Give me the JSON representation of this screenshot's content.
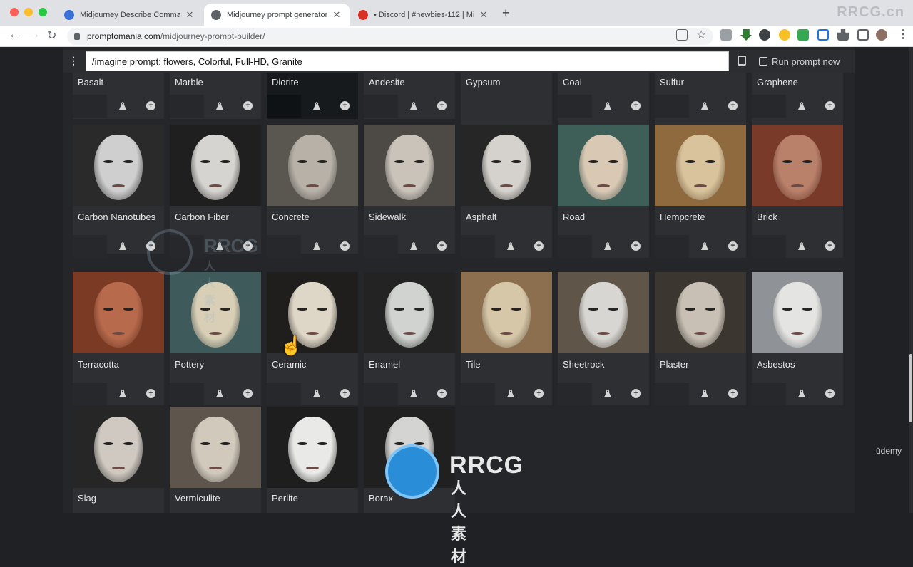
{
  "browser": {
    "tabs": [
      {
        "title": "Midjourney Describe Comman",
        "active": false,
        "favicon_color": "#3b6fd8"
      },
      {
        "title": "Midjourney prompt generator",
        "active": true,
        "favicon_color": "#5f6368"
      },
      {
        "title": "• Discord | #newbies-112 | Mid",
        "active": false,
        "favicon_color": "#d93025"
      }
    ],
    "new_tab": "+",
    "close": "✕",
    "url_domain": "promptomania.com",
    "url_path": "/midjourney-prompt-builder/",
    "watermark": "RRCG.cn"
  },
  "app": {
    "prompt_text": "/imagine prompt: flowers, Colorful, Full-HD, Granite",
    "run_label": "Run prompt now",
    "menu_icon": "⋮"
  },
  "materials_top": [
    {
      "name": "Basalt"
    },
    {
      "name": "Marble"
    },
    {
      "name": "Diorite"
    },
    {
      "name": "Andesite"
    },
    {
      "name": "Gypsum"
    },
    {
      "name": "Coal"
    },
    {
      "name": "Sulfur"
    },
    {
      "name": "Graphene"
    }
  ],
  "materials_row1": [
    {
      "name": "Carbon Nanotubes",
      "tone": "#cfcfcf",
      "bg": "#2a2a2a"
    },
    {
      "name": "Carbon Fiber",
      "tone": "#d6d4d0",
      "bg": "#1f1f1f"
    },
    {
      "name": "Concrete",
      "tone": "#b7b1a8",
      "bg": "#5a5650"
    },
    {
      "name": "Sidewalk",
      "tone": "#c9c3ba",
      "bg": "#4d4a46"
    },
    {
      "name": "Asphalt",
      "tone": "#d5d2cd",
      "bg": "#262626"
    },
    {
      "name": "Road",
      "tone": "#d9c8b4",
      "bg": "#3e5f58"
    },
    {
      "name": "Hempcrete",
      "tone": "#d8c39c",
      "bg": "#8f6a3e"
    },
    {
      "name": "Brick",
      "tone": "#b9806a",
      "bg": "#7a3a2a"
    }
  ],
  "materials_row2": [
    {
      "name": "Terracotta",
      "tone": "#b86a4c",
      "bg": "#7a3a24"
    },
    {
      "name": "Pottery",
      "tone": "#d9cfb6",
      "bg": "#3f5a5a"
    },
    {
      "name": "Ceramic",
      "tone": "#ded6c6",
      "bg": "#1f1e1c"
    },
    {
      "name": "Enamel",
      "tone": "#d0d3cf",
      "bg": "#232323"
    },
    {
      "name": "Tile",
      "tone": "#d6c7a9",
      "bg": "#8c6f4f"
    },
    {
      "name": "Sheetrock",
      "tone": "#d8d6d2",
      "bg": "#5f5649"
    },
    {
      "name": "Plaster",
      "tone": "#c8c0b4",
      "bg": "#3c3631"
    },
    {
      "name": "Asbestos",
      "tone": "#e4e4e2",
      "bg": "#8f9397"
    }
  ],
  "materials_row3": [
    {
      "name": "Slag",
      "tone": "#cfc9c1",
      "bg": "#262626"
    },
    {
      "name": "Vermiculite",
      "tone": "#d1c9bc",
      "bg": "#5e564d"
    },
    {
      "name": "Perlite",
      "tone": "#e9e9e7",
      "bg": "#1e1e1e"
    },
    {
      "name": "Borax",
      "tone": "#d4d4d2",
      "bg": "#202020"
    }
  ],
  "overlays": {
    "rrcg": "RRCG",
    "rrcg_cn": "人人素材",
    "udemy": "ūdemy"
  },
  "colors": {
    "page_bg": "#24262a",
    "card_bg": "#2d2f33",
    "accent_text": "#e6e6e6"
  }
}
